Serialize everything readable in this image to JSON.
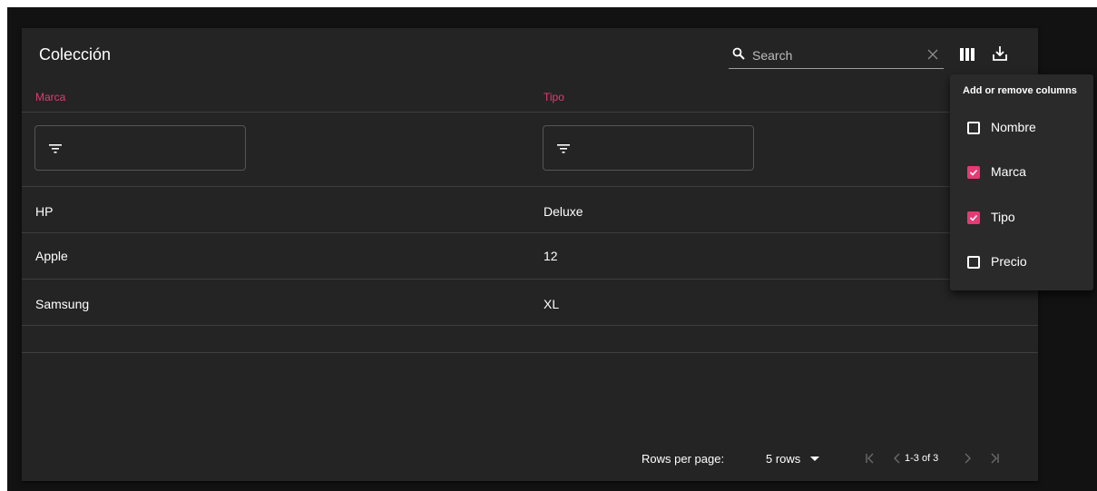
{
  "table": {
    "title": "Colección",
    "search_placeholder": "Search",
    "columns": [
      {
        "label": "Marca"
      },
      {
        "label": "Tipo"
      }
    ],
    "rows": [
      {
        "marca": "HP",
        "tipo": "Deluxe"
      },
      {
        "marca": "Apple",
        "tipo": "12"
      },
      {
        "marca": "Samsung",
        "tipo": "XL"
      }
    ]
  },
  "footer": {
    "rows_per_page_label": "Rows per page:",
    "rows_per_page_value": "5 rows",
    "range": "1-3 of 3"
  },
  "columns_menu": {
    "title": "Add or remove columns",
    "items": [
      {
        "label": "Nombre",
        "checked": false
      },
      {
        "label": "Marca",
        "checked": true
      },
      {
        "label": "Tipo",
        "checked": true
      },
      {
        "label": "Precio",
        "checked": false
      }
    ]
  },
  "colors": {
    "accent": "#e63a73",
    "panel": "#242424",
    "background": "#121212"
  },
  "icons": [
    "search-icon",
    "clear-icon",
    "view-column-icon",
    "download-icon",
    "filter-icon",
    "arrow-drop-down-icon",
    "first-page-icon",
    "chevron-left-icon",
    "chevron-right-icon",
    "last-page-icon",
    "checkbox-icon"
  ]
}
